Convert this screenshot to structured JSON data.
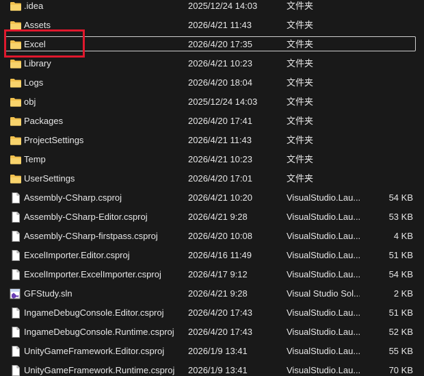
{
  "colors": {
    "background": "#191919",
    "text": "#e6e6e6",
    "folder": "#f2c14e",
    "selection_border": "#cfcfcf",
    "annotation_red": "#e0182d"
  },
  "files": [
    {
      "name": ".idea",
      "date": "2025/12/24 14:03",
      "type": "文件夹",
      "size": "",
      "icon": "folder-icon"
    },
    {
      "name": "Assets",
      "date": "2026/4/21 11:43",
      "type": "文件夹",
      "size": "",
      "icon": "folder-icon"
    },
    {
      "name": "Excel",
      "date": "2026/4/20 17:35",
      "type": "文件夹",
      "size": "",
      "icon": "folder-icon",
      "selected": true
    },
    {
      "name": "Library",
      "date": "2026/4/21 10:23",
      "type": "文件夹",
      "size": "",
      "icon": "folder-icon"
    },
    {
      "name": "Logs",
      "date": "2026/4/20 18:04",
      "type": "文件夹",
      "size": "",
      "icon": "folder-icon"
    },
    {
      "name": "obj",
      "date": "2025/12/24 14:03",
      "type": "文件夹",
      "size": "",
      "icon": "folder-icon"
    },
    {
      "name": "Packages",
      "date": "2026/4/20 17:41",
      "type": "文件夹",
      "size": "",
      "icon": "folder-icon"
    },
    {
      "name": "ProjectSettings",
      "date": "2026/4/21 11:43",
      "type": "文件夹",
      "size": "",
      "icon": "folder-icon"
    },
    {
      "name": "Temp",
      "date": "2026/4/21 10:23",
      "type": "文件夹",
      "size": "",
      "icon": "folder-icon"
    },
    {
      "name": "UserSettings",
      "date": "2026/4/20 17:01",
      "type": "文件夹",
      "size": "",
      "icon": "folder-icon"
    },
    {
      "name": "Assembly-CSharp.csproj",
      "date": "2026/4/21 10:20",
      "type": "VisualStudio.Lau...",
      "size": "54 KB",
      "icon": "document-icon"
    },
    {
      "name": "Assembly-CSharp-Editor.csproj",
      "date": "2026/4/21 9:28",
      "type": "VisualStudio.Lau...",
      "size": "53 KB",
      "icon": "document-icon"
    },
    {
      "name": "Assembly-CSharp-firstpass.csproj",
      "date": "2026/4/20 10:08",
      "type": "VisualStudio.Lau...",
      "size": "4 KB",
      "icon": "document-icon"
    },
    {
      "name": "ExcelImporter.Editor.csproj",
      "date": "2026/4/16 11:49",
      "type": "VisualStudio.Lau...",
      "size": "51 KB",
      "icon": "document-icon"
    },
    {
      "name": "ExcelImporter.ExcelImporter.csproj",
      "date": "2026/4/17 9:12",
      "type": "VisualStudio.Lau...",
      "size": "54 KB",
      "icon": "document-icon"
    },
    {
      "name": "GFStudy.sln",
      "date": "2026/4/21 9:28",
      "type": "Visual Studio Sol...",
      "size": "2 KB",
      "icon": "visual-studio-solution-icon"
    },
    {
      "name": "IngameDebugConsole.Editor.csproj",
      "date": "2026/4/20 17:43",
      "type": "VisualStudio.Lau...",
      "size": "51 KB",
      "icon": "document-icon"
    },
    {
      "name": "IngameDebugConsole.Runtime.csproj",
      "date": "2026/4/20 17:43",
      "type": "VisualStudio.Lau...",
      "size": "52 KB",
      "icon": "document-icon"
    },
    {
      "name": "UnityGameFramework.Editor.csproj",
      "date": "2026/1/9 13:41",
      "type": "VisualStudio.Lau...",
      "size": "55 KB",
      "icon": "document-icon"
    },
    {
      "name": "UnityGameFramework.Runtime.csproj",
      "date": "2026/1/9 13:41",
      "type": "VisualStudio.Lau...",
      "size": "70 KB",
      "icon": "document-icon"
    }
  ]
}
